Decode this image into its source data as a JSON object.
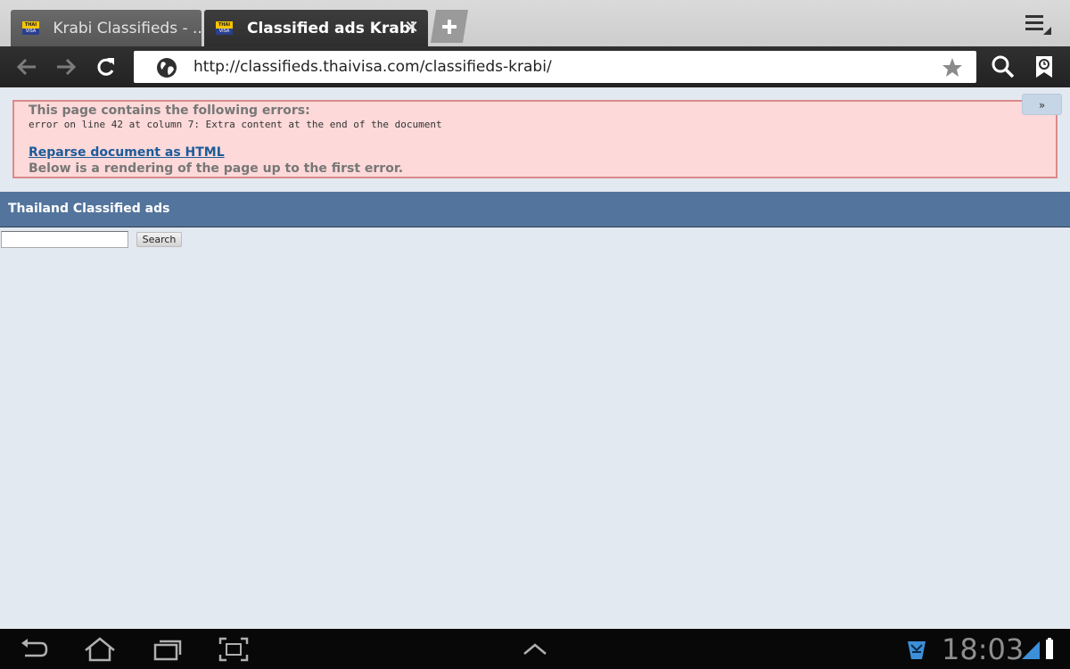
{
  "tabs": [
    {
      "title": "Krabi Classifieds - ...",
      "active": false
    },
    {
      "title": "Classified ads Krabi",
      "active": true
    }
  ],
  "favicon": {
    "top_text": "THAI",
    "bottom_text": "VISA"
  },
  "address_bar": {
    "url": "http://classifieds.thaivisa.com/classifieds-krabi/"
  },
  "error_box": {
    "title": "This page contains the following errors:",
    "message": "error on line 42 at column 7: Extra content at the end of the document",
    "link": "Reparse document as HTML",
    "note": "Below is a rendering of the page up to the first error.",
    "expand_label": "»"
  },
  "page": {
    "banner_title": "Thailand Classified ads",
    "search_value": "",
    "search_button": "Search"
  },
  "status": {
    "time": "18:03"
  },
  "colors": {
    "banner": "#53749c",
    "error_bg": "#fdd9d9",
    "error_border": "#d98a8a",
    "link": "#1b5c9a"
  },
  "icons": [
    "back-arrow-icon",
    "forward-arrow-icon",
    "reload-icon",
    "globe-icon",
    "star-icon",
    "search-icon",
    "bookmarks-icon",
    "menu-icon",
    "new-tab-icon",
    "system-back-icon",
    "home-icon",
    "recent-apps-icon",
    "screenshot-icon",
    "chevron-up-icon",
    "notification-icon",
    "signal-icon",
    "battery-icon"
  ]
}
